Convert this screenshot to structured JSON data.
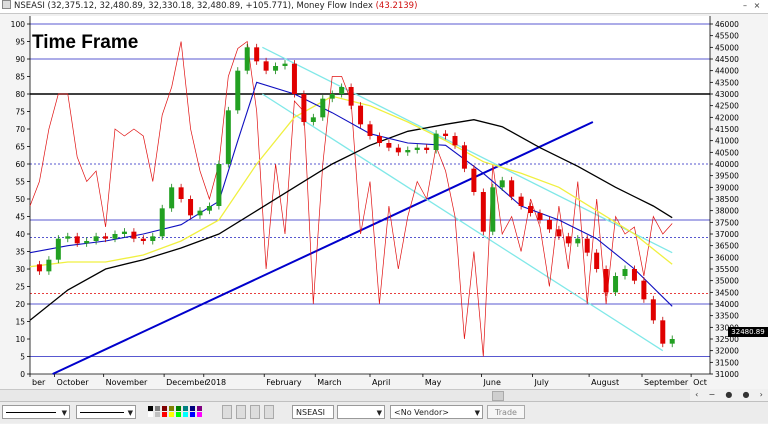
{
  "window": {
    "title_text": "NSEASI (32,375.12, 32,480.89, 32,330.18, 32,480.89, +105.771), Money Flow Index ",
    "mfi_value": "(43.2139)",
    "mfi_color": "#d01010"
  },
  "frame_title": "Time Frame",
  "price_tag": "32480.89",
  "toolbar": {
    "symbol": "NSEASI",
    "vendor": "<No Vendor>",
    "trade_label": "Trade"
  },
  "chart_data": {
    "type": "line",
    "title": "",
    "left_axis": {
      "min": 0,
      "max": 100,
      "ticks": [
        0,
        5,
        10,
        15,
        20,
        25,
        30,
        35,
        40,
        45,
        50,
        55,
        60,
        65,
        70,
        75,
        80,
        85,
        90,
        95,
        100
      ]
    },
    "right_axis": {
      "min": 31000,
      "max": 46000,
      "ticks": [
        31000,
        31500,
        32000,
        32500,
        33000,
        33500,
        34000,
        34500,
        35000,
        35500,
        36000,
        36500,
        37000,
        37500,
        38000,
        38500,
        39000,
        39500,
        40000,
        40500,
        41000,
        41500,
        42000,
        42500,
        43000,
        43500,
        44000,
        44500,
        45000,
        45500,
        46000
      ]
    },
    "x_labels": [
      "ber",
      "October",
      "November",
      "December",
      "2018",
      "February",
      "March",
      "April",
      "May",
      "June",
      "July",
      "August",
      "September",
      "Oct"
    ],
    "x_label_pos": [
      0,
      1.3,
      3.9,
      7.1,
      9.2,
      12.4,
      15.1,
      18.0,
      20.8,
      23.9,
      26.6,
      29.6,
      32.4,
      35.0
    ],
    "x_max": 36,
    "horizontal_lines": [
      {
        "value_mfi": 100,
        "color": "#2020c0"
      },
      {
        "value_mfi": 90,
        "color": "#2020c0"
      },
      {
        "value_mfi": 80,
        "color": "#000000",
        "heavy": true
      },
      {
        "value_mfi": 60,
        "color": "#2020c0",
        "dashed": true
      },
      {
        "value_mfi": 44,
        "color": "#2020c0"
      },
      {
        "value_mfi": 39,
        "color": "#2020c0",
        "dashed": true
      },
      {
        "value_mfi": 23,
        "color": "#e00000",
        "dashed": true
      },
      {
        "value_mfi": 20,
        "color": "#2020c0"
      },
      {
        "value_mfi": 5,
        "color": "#2020c0"
      }
    ],
    "price": [
      {
        "t": 0,
        "v": 35700
      },
      {
        "t": 0.5,
        "v": 35400
      },
      {
        "t": 1,
        "v": 35900
      },
      {
        "t": 1.5,
        "v": 36800
      },
      {
        "t": 2,
        "v": 36900
      },
      {
        "t": 2.5,
        "v": 36600
      },
      {
        "t": 3,
        "v": 36700
      },
      {
        "t": 3.5,
        "v": 36900
      },
      {
        "t": 4,
        "v": 36800
      },
      {
        "t": 4.5,
        "v": 37000
      },
      {
        "t": 5,
        "v": 37100
      },
      {
        "t": 5.5,
        "v": 36800
      },
      {
        "t": 6,
        "v": 36700
      },
      {
        "t": 6.5,
        "v": 36900
      },
      {
        "t": 7,
        "v": 38100
      },
      {
        "t": 7.5,
        "v": 39000
      },
      {
        "t": 8,
        "v": 38500
      },
      {
        "t": 8.5,
        "v": 37800
      },
      {
        "t": 9,
        "v": 38000
      },
      {
        "t": 9.5,
        "v": 38200
      },
      {
        "t": 10,
        "v": 40000
      },
      {
        "t": 10.5,
        "v": 42300
      },
      {
        "t": 11,
        "v": 44000
      },
      {
        "t": 11.5,
        "v": 45000
      },
      {
        "t": 12,
        "v": 44400
      },
      {
        "t": 12.5,
        "v": 44000
      },
      {
        "t": 13,
        "v": 44200
      },
      {
        "t": 13.5,
        "v": 44300
      },
      {
        "t": 14,
        "v": 43000
      },
      {
        "t": 14.5,
        "v": 41800
      },
      {
        "t": 15,
        "v": 42000
      },
      {
        "t": 15.5,
        "v": 42800
      },
      {
        "t": 16,
        "v": 43000
      },
      {
        "t": 16.5,
        "v": 43300
      },
      {
        "t": 17,
        "v": 42500
      },
      {
        "t": 17.5,
        "v": 41700
      },
      {
        "t": 18,
        "v": 41200
      },
      {
        "t": 18.5,
        "v": 40900
      },
      {
        "t": 19,
        "v": 40700
      },
      {
        "t": 19.5,
        "v": 40500
      },
      {
        "t": 20,
        "v": 40600
      },
      {
        "t": 20.5,
        "v": 40700
      },
      {
        "t": 21,
        "v": 40600
      },
      {
        "t": 21.5,
        "v": 41300
      },
      {
        "t": 22,
        "v": 41200
      },
      {
        "t": 22.5,
        "v": 40800
      },
      {
        "t": 23,
        "v": 39800
      },
      {
        "t": 23.5,
        "v": 38800
      },
      {
        "t": 24,
        "v": 37100
      },
      {
        "t": 24.5,
        "v": 39000
      },
      {
        "t": 25,
        "v": 39300
      },
      {
        "t": 25.5,
        "v": 38600
      },
      {
        "t": 26,
        "v": 38200
      },
      {
        "t": 26.5,
        "v": 37900
      },
      {
        "t": 27,
        "v": 37600
      },
      {
        "t": 27.5,
        "v": 37200
      },
      {
        "t": 28,
        "v": 36900
      },
      {
        "t": 28.5,
        "v": 36600
      },
      {
        "t": 29,
        "v": 36800
      },
      {
        "t": 29.5,
        "v": 36200
      },
      {
        "t": 30,
        "v": 35500
      },
      {
        "t": 30.5,
        "v": 34500
      },
      {
        "t": 31,
        "v": 35200
      },
      {
        "t": 31.5,
        "v": 35500
      },
      {
        "t": 32,
        "v": 35000
      },
      {
        "t": 32.5,
        "v": 34200
      },
      {
        "t": 33,
        "v": 33300
      },
      {
        "t": 33.5,
        "v": 32300
      },
      {
        "t": 34,
        "v": 32500
      }
    ],
    "mfi": [
      {
        "t": 0,
        "v": 48
      },
      {
        "t": 0.5,
        "v": 55
      },
      {
        "t": 1,
        "v": 70
      },
      {
        "t": 1.5,
        "v": 80
      },
      {
        "t": 2,
        "v": 80
      },
      {
        "t": 2.5,
        "v": 62
      },
      {
        "t": 3,
        "v": 55
      },
      {
        "t": 3.5,
        "v": 58
      },
      {
        "t": 4,
        "v": 42
      },
      {
        "t": 4.5,
        "v": 70
      },
      {
        "t": 5,
        "v": 68
      },
      {
        "t": 5.5,
        "v": 70
      },
      {
        "t": 6,
        "v": 68
      },
      {
        "t": 6.5,
        "v": 55
      },
      {
        "t": 7,
        "v": 74
      },
      {
        "t": 7.5,
        "v": 82
      },
      {
        "t": 8,
        "v": 95
      },
      {
        "t": 8.5,
        "v": 70
      },
      {
        "t": 9,
        "v": 58
      },
      {
        "t": 9.5,
        "v": 50
      },
      {
        "t": 10,
        "v": 60
      },
      {
        "t": 10.5,
        "v": 85
      },
      {
        "t": 11,
        "v": 93
      },
      {
        "t": 11.5,
        "v": 95
      },
      {
        "t": 12,
        "v": 75
      },
      {
        "t": 12.5,
        "v": 30
      },
      {
        "t": 13,
        "v": 60
      },
      {
        "t": 13.5,
        "v": 40
      },
      {
        "t": 14,
        "v": 78
      },
      {
        "t": 14.5,
        "v": 75
      },
      {
        "t": 15,
        "v": 20
      },
      {
        "t": 15.5,
        "v": 60
      },
      {
        "t": 16,
        "v": 85
      },
      {
        "t": 16.5,
        "v": 85
      },
      {
        "t": 17,
        "v": 78
      },
      {
        "t": 17.5,
        "v": 40
      },
      {
        "t": 18,
        "v": 55
      },
      {
        "t": 18.5,
        "v": 20
      },
      {
        "t": 19,
        "v": 48
      },
      {
        "t": 19.5,
        "v": 30
      },
      {
        "t": 20,
        "v": 45
      },
      {
        "t": 20.5,
        "v": 55
      },
      {
        "t": 21,
        "v": 50
      },
      {
        "t": 21.5,
        "v": 65
      },
      {
        "t": 22,
        "v": 58
      },
      {
        "t": 22.5,
        "v": 45
      },
      {
        "t": 23,
        "v": 10
      },
      {
        "t": 23.5,
        "v": 35
      },
      {
        "t": 24,
        "v": 5
      },
      {
        "t": 24.5,
        "v": 60
      },
      {
        "t": 25,
        "v": 40
      },
      {
        "t": 25.5,
        "v": 45
      },
      {
        "t": 26,
        "v": 35
      },
      {
        "t": 26.5,
        "v": 50
      },
      {
        "t": 27,
        "v": 42
      },
      {
        "t": 27.5,
        "v": 25
      },
      {
        "t": 28,
        "v": 48
      },
      {
        "t": 28.5,
        "v": 30
      },
      {
        "t": 29,
        "v": 55
      },
      {
        "t": 29.5,
        "v": 20
      },
      {
        "t": 30,
        "v": 50
      },
      {
        "t": 30.5,
        "v": 20
      },
      {
        "t": 31,
        "v": 45
      },
      {
        "t": 31.5,
        "v": 40
      },
      {
        "t": 32,
        "v": 42
      },
      {
        "t": 32.5,
        "v": 28
      },
      {
        "t": 33,
        "v": 45
      },
      {
        "t": 33.5,
        "v": 40
      },
      {
        "t": 34,
        "v": 43
      }
    ],
    "sma_black": [
      {
        "t": 0,
        "v": 33300
      },
      {
        "t": 2,
        "v": 34600
      },
      {
        "t": 4,
        "v": 35500
      },
      {
        "t": 6,
        "v": 35900
      },
      {
        "t": 8,
        "v": 36400
      },
      {
        "t": 10,
        "v": 37000
      },
      {
        "t": 12,
        "v": 38000
      },
      {
        "t": 14,
        "v": 39000
      },
      {
        "t": 16,
        "v": 40000
      },
      {
        "t": 18,
        "v": 40800
      },
      {
        "t": 20,
        "v": 41400
      },
      {
        "t": 22,
        "v": 41700
      },
      {
        "t": 23.5,
        "v": 41900
      },
      {
        "t": 25,
        "v": 41600
      },
      {
        "t": 27,
        "v": 40700
      },
      {
        "t": 29,
        "v": 39900
      },
      {
        "t": 31,
        "v": 39000
      },
      {
        "t": 33,
        "v": 38200
      },
      {
        "t": 34,
        "v": 37700
      }
    ],
    "sma_yellow": [
      {
        "t": 0,
        "v": 35600
      },
      {
        "t": 2,
        "v": 35800
      },
      {
        "t": 4,
        "v": 35800
      },
      {
        "t": 6,
        "v": 36100
      },
      {
        "t": 8,
        "v": 36700
      },
      {
        "t": 10,
        "v": 37600
      },
      {
        "t": 12,
        "v": 40000
      },
      {
        "t": 14,
        "v": 42000
      },
      {
        "t": 16,
        "v": 42900
      },
      {
        "t": 18,
        "v": 42500
      },
      {
        "t": 20,
        "v": 41800
      },
      {
        "t": 22,
        "v": 41000
      },
      {
        "t": 24,
        "v": 40100
      },
      {
        "t": 26,
        "v": 39600
      },
      {
        "t": 28,
        "v": 39000
      },
      {
        "t": 30,
        "v": 38000
      },
      {
        "t": 32,
        "v": 37000
      },
      {
        "t": 34,
        "v": 35700
      }
    ],
    "sma_blue": [
      {
        "t": 0,
        "v": 36200
      },
      {
        "t": 2,
        "v": 36500
      },
      {
        "t": 4,
        "v": 36700
      },
      {
        "t": 6,
        "v": 37000
      },
      {
        "t": 8,
        "v": 37400
      },
      {
        "t": 10,
        "v": 38400
      },
      {
        "t": 11,
        "v": 41000
      },
      {
        "t": 12,
        "v": 43500
      },
      {
        "t": 14,
        "v": 43000
      },
      {
        "t": 16,
        "v": 42200
      },
      {
        "t": 18,
        "v": 41300
      },
      {
        "t": 20,
        "v": 40900
      },
      {
        "t": 22,
        "v": 40800
      },
      {
        "t": 24,
        "v": 39600
      },
      {
        "t": 26,
        "v": 38200
      },
      {
        "t": 28,
        "v": 37600
      },
      {
        "t": 30,
        "v": 36800
      },
      {
        "t": 32,
        "v": 35500
      },
      {
        "t": 34,
        "v": 33900
      }
    ],
    "trendlines": [
      {
        "color": "#0000cc",
        "width": 2,
        "t1": 1.2,
        "v1": 31000,
        "t2": 29.8,
        "v2": 41800
      },
      {
        "color": "#80e8e8",
        "width": 1.3,
        "t1": 12.3,
        "v1": 45000,
        "t2": 34.0,
        "v2": 36200
      },
      {
        "color": "#80e8e8",
        "width": 1.3,
        "t1": 12.3,
        "v1": 43000,
        "t2": 33.5,
        "v2": 32000
      }
    ]
  }
}
